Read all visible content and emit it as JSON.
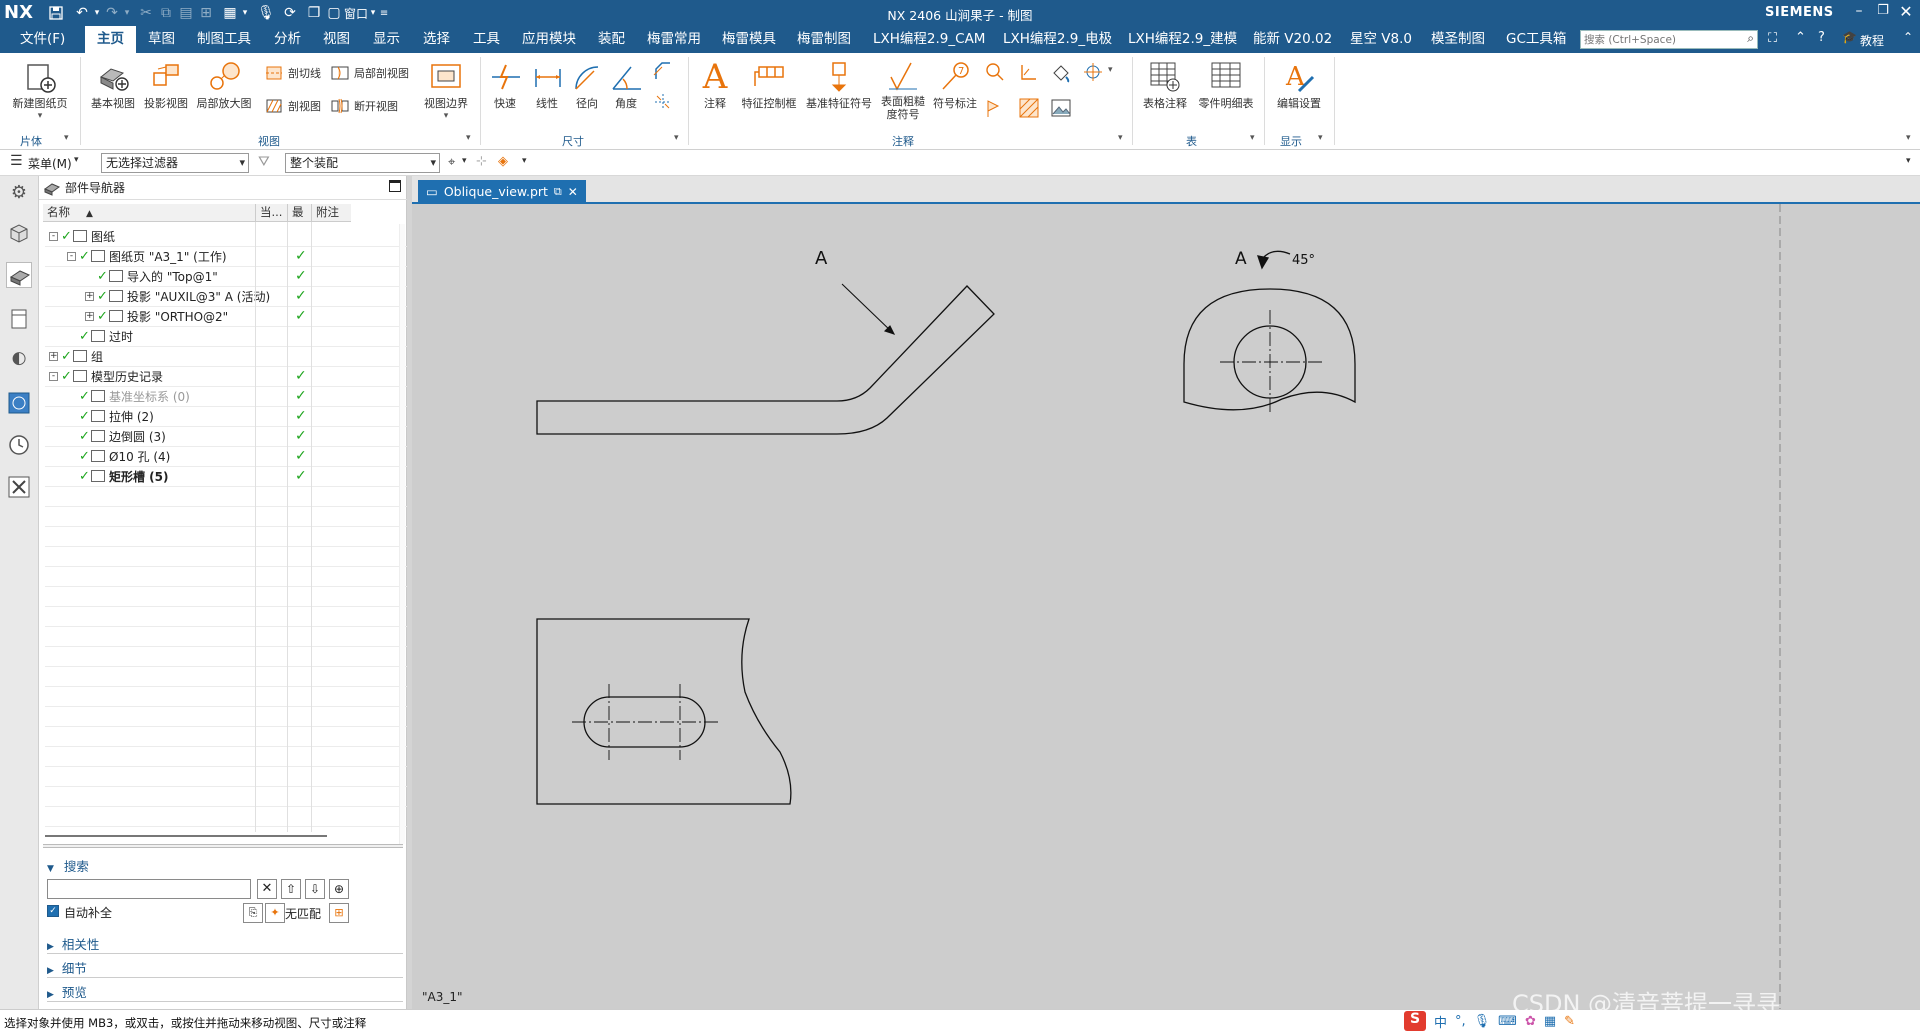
{
  "titlebar": {
    "logo": "NX",
    "window_text": "窗口",
    "title": "NX 2406 山涧果子 - 制图",
    "brand": "SIEMENS",
    "search_placeholder": "搜索 (Ctrl+Space)",
    "tutorial": "教程",
    "icons": [
      "save-icon",
      "undo-icon",
      "redo-icon",
      "mic-icon",
      "window-icon",
      "fullscreen-icon",
      "help-icon",
      "tutorial-icon",
      "minimize-icon",
      "restore-icon",
      "close-icon"
    ]
  },
  "menubar": {
    "items": [
      "文件(F)",
      "主页",
      "草图",
      "制图工具",
      "分析",
      "视图",
      "显示",
      "选择",
      "工具",
      "应用模块",
      "装配",
      "梅雷常用",
      "梅雷模具",
      "梅雷制图",
      "LXH编程2.9_CAM",
      "LXH编程2.9_电极",
      "LXH编程2.9_建模",
      "能新 V20.02",
      "星空 V8.0",
      "模圣制图",
      "GC工具箱"
    ],
    "active": "主页"
  },
  "ribbon": {
    "new_sheet": "新建图纸页",
    "base_view": "基本视图",
    "projected_view": "投影视图",
    "detail_view": "局部放大图",
    "section_line": "剖切线",
    "section_view": "剖视图",
    "breakout_section": "局部剖视图",
    "break_view": "断开视图",
    "view_boundary": "视图边界",
    "rapid": "快速",
    "linear": "线性",
    "radial": "径向",
    "angular": "角度",
    "note": "注释",
    "fcf": "特征控制框",
    "datum_symbol": "基准特征符号",
    "surface_finish_l1": "表面粗糙",
    "surface_finish_l2": "度符号",
    "symbol_annotation": "符号标注",
    "tabular_note": "表格注释",
    "parts_list": "零件明细表",
    "edit_settings": "编辑设置",
    "groups": {
      "sheet": "片体",
      "view": "视图",
      "dimension": "尺寸",
      "annotation": "注释",
      "table": "表",
      "display": "显示"
    }
  },
  "selbar": {
    "menu": "菜单(M)",
    "filter": "无选择过滤器",
    "scope": "整个装配"
  },
  "navigator": {
    "title": "部件导航器",
    "columns": [
      "名称",
      "当...",
      "最",
      "附注"
    ],
    "rows": [
      {
        "label": "图纸",
        "indent": 0,
        "expander": "-",
        "check1": false,
        "check2": false,
        "bold": false,
        "dim": false
      },
      {
        "label": "图纸页 \"A3_1\" (工作)",
        "indent": 1,
        "expander": "-",
        "check1": false,
        "check2": true,
        "bold": false,
        "dim": false
      },
      {
        "label": "导入的 \"Top@1\"",
        "indent": 2,
        "expander": "",
        "check1": false,
        "check2": true,
        "bold": false,
        "dim": false
      },
      {
        "label": "投影 \"AUXIL@3\" A (活动)",
        "indent": 2,
        "expander": "+",
        "check1": false,
        "check2": true,
        "bold": false,
        "dim": false
      },
      {
        "label": "投影 \"ORTHO@2\"",
        "indent": 2,
        "expander": "+",
        "check1": false,
        "check2": true,
        "bold": false,
        "dim": false
      },
      {
        "label": "过时",
        "indent": 1,
        "expander": "",
        "check1": false,
        "check2": false,
        "bold": false,
        "dim": false
      },
      {
        "label": "组",
        "indent": 0,
        "expander": "+",
        "check1": false,
        "check2": false,
        "bold": false,
        "dim": false
      },
      {
        "label": "模型历史记录",
        "indent": 0,
        "expander": "-",
        "check1": false,
        "check2": true,
        "bold": false,
        "dim": false
      },
      {
        "label": "基准坐标系 (0)",
        "indent": 1,
        "expander": "",
        "check1": false,
        "check2": true,
        "bold": false,
        "dim": true
      },
      {
        "label": "拉伸 (2)",
        "indent": 1,
        "expander": "",
        "check1": false,
        "check2": true,
        "bold": false,
        "dim": false
      },
      {
        "label": "边倒圆 (3)",
        "indent": 1,
        "expander": "",
        "check1": false,
        "check2": true,
        "bold": false,
        "dim": false
      },
      {
        "label": "Ø10 孔 (4)",
        "indent": 1,
        "expander": "",
        "check1": false,
        "check2": true,
        "bold": false,
        "dim": false
      },
      {
        "label": "矩形槽 (5)",
        "indent": 1,
        "expander": "",
        "check1": false,
        "check2": true,
        "bold": true,
        "dim": false
      }
    ],
    "search_title": "搜索",
    "auto_complete": "自动补全",
    "no_match": "无匹配",
    "sections": [
      "相关性",
      "细节",
      "预览"
    ]
  },
  "document": {
    "tab": "Oblique_view.prt",
    "sheet_label": "\"A3_1\"",
    "view_label_a": "A",
    "view_label_a2": "A",
    "rotation": "45°"
  },
  "status": {
    "text": "选择对象并使用 MB3，或双击，或按住并拖动来移动视图、尺寸或注释",
    "ime": "中",
    "watermark": "CSDN @清音菩提一寻寻"
  },
  "colors": {
    "title_blue": "#1f5a8c",
    "tab_blue": "#1f6fb0",
    "check_green": "#1ea51e",
    "accent_orange": "#e8740c"
  }
}
